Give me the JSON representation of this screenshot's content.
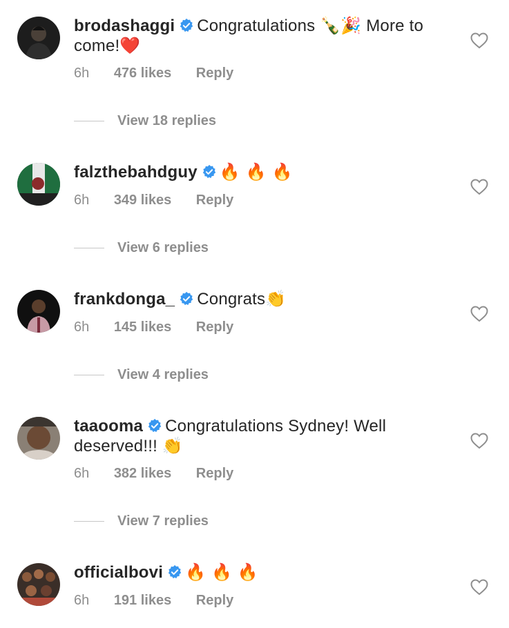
{
  "comments": [
    {
      "username": "brodashaggi",
      "text": "Congratulations 🍾🎉 More to come!❤️",
      "time": "6h",
      "likes": "476 likes",
      "reply_label": "Reply",
      "view_replies": "View 18 replies",
      "verified": true
    },
    {
      "username": "falzthebahdguy",
      "text": "🔥 🔥 🔥",
      "time": "6h",
      "likes": "349 likes",
      "reply_label": "Reply",
      "view_replies": "View 6 replies",
      "verified": true
    },
    {
      "username": "frankdonga_",
      "text": "Congrats👏",
      "time": "6h",
      "likes": "145 likes",
      "reply_label": "Reply",
      "view_replies": "View 4 replies",
      "verified": true
    },
    {
      "username": "taaooma",
      "text": "Congratulations Sydney! Well deserved!!! 👏",
      "time": "6h",
      "likes": "382 likes",
      "reply_label": "Reply",
      "view_replies": "View 7 replies",
      "verified": true
    },
    {
      "username": "officialbovi",
      "text": "🔥 🔥 🔥",
      "time": "6h",
      "likes": "191 likes",
      "reply_label": "Reply",
      "verified": true
    }
  ],
  "colors": {
    "text": "#262626",
    "secondary": "#8e8e8e",
    "verified_blue": "#3897f0",
    "divider": "#c7c7c7"
  },
  "icons": {
    "verified": "verified-badge-icon",
    "like": "heart-outline-icon"
  }
}
